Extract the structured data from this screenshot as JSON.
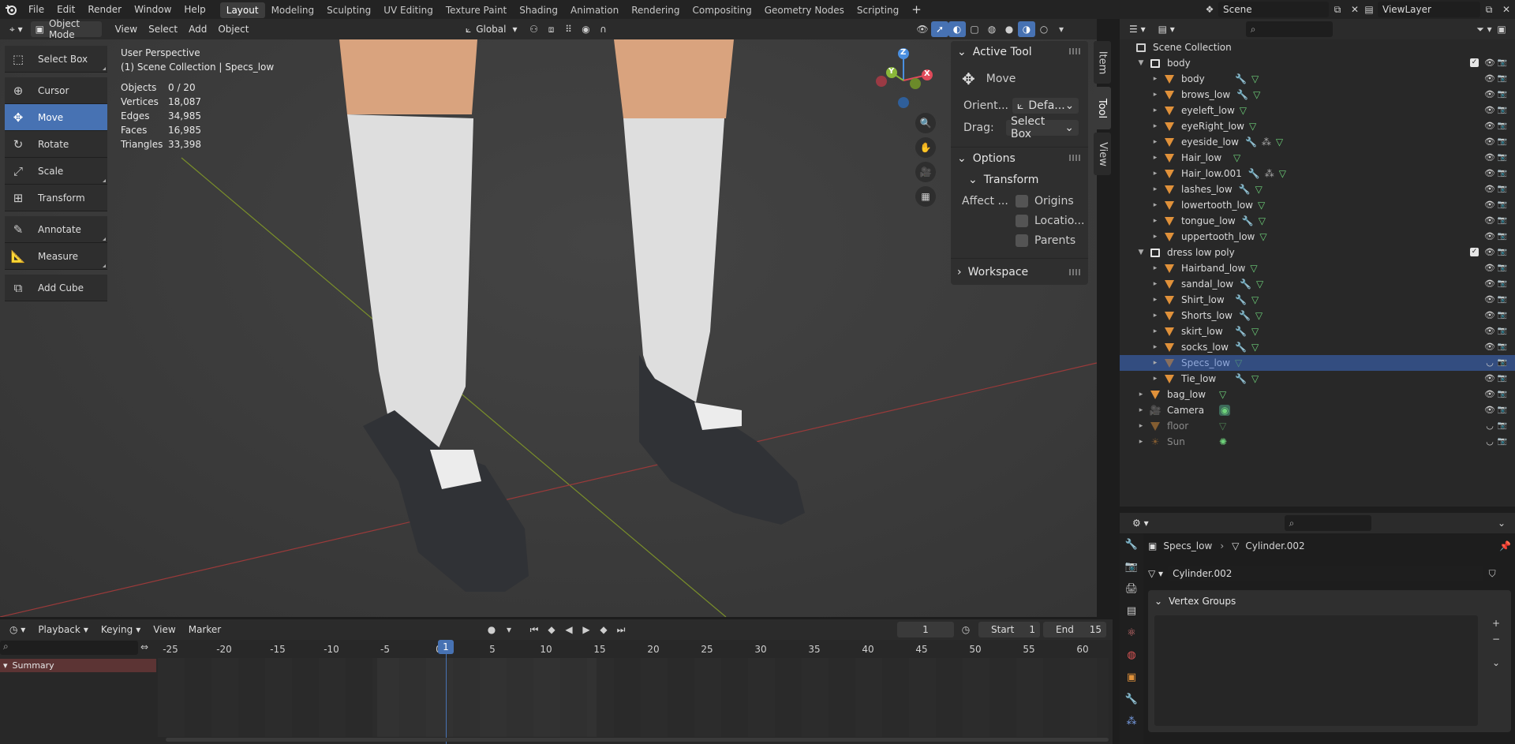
{
  "topbar": {
    "menus": [
      "File",
      "Edit",
      "Render",
      "Window",
      "Help"
    ],
    "workspaces": [
      "Layout",
      "Modeling",
      "Sculpting",
      "UV Editing",
      "Texture Paint",
      "Shading",
      "Animation",
      "Rendering",
      "Compositing",
      "Geometry Nodes",
      "Scripting"
    ],
    "active_workspace": "Layout",
    "add_tab": "+",
    "scene": "Scene",
    "view_layer": "ViewLayer"
  },
  "viewport_header": {
    "mode": "Object Mode",
    "menus": [
      "View",
      "Select",
      "Add",
      "Object"
    ],
    "orientation": "Global"
  },
  "overlay": {
    "perspective": "User Perspective",
    "collection": "(1) Scene Collection | Specs_low",
    "stats": [
      {
        "label": "Objects",
        "value": "0 / 20"
      },
      {
        "label": "Vertices",
        "value": "18,087"
      },
      {
        "label": "Edges",
        "value": "34,985"
      },
      {
        "label": "Faces",
        "value": "16,985"
      },
      {
        "label": "Triangles",
        "value": "33,398"
      }
    ]
  },
  "toolbox": {
    "tools": [
      {
        "label": "Select Box",
        "icon": "select-box-icon",
        "glyph": "⬚"
      },
      {
        "label": "Cursor",
        "icon": "cursor-icon",
        "glyph": "⊕"
      },
      {
        "label": "Move",
        "icon": "move-icon",
        "glyph": "✥"
      },
      {
        "label": "Rotate",
        "icon": "rotate-icon",
        "glyph": "↻"
      },
      {
        "label": "Scale",
        "icon": "scale-icon",
        "glyph": "⤢"
      },
      {
        "label": "Transform",
        "icon": "transform-icon",
        "glyph": "⊞"
      },
      {
        "label": "Annotate",
        "icon": "annotate-icon",
        "glyph": "✎"
      },
      {
        "label": "Measure",
        "icon": "measure-icon",
        "glyph": "📐"
      },
      {
        "label": "Add Cube",
        "icon": "add-cube-icon",
        "glyph": "⧉"
      }
    ],
    "active": "Move"
  },
  "gizmo": {
    "x": "X",
    "y": "Y",
    "z": "Z"
  },
  "npanel": {
    "active_tool_title": "Active Tool",
    "tool_name": "Move",
    "orient_label": "Orient...",
    "orient_value": "Defa...",
    "drag_label": "Drag:",
    "drag_value": "Select Box",
    "options_title": "Options",
    "transform_title": "Transform",
    "affect_label": "Affect ...",
    "checks": [
      "Origins",
      "Locatio...",
      "Parents"
    ],
    "workspace_title": "Workspace",
    "tabs": [
      "Item",
      "Tool",
      "View"
    ]
  },
  "outliner": {
    "root": "Scene Collection",
    "rows": [
      {
        "name": "body",
        "depth": 1,
        "kind": "collection",
        "mod": false,
        "extra": false,
        "mesh": false,
        "sel": false,
        "dim": false
      },
      {
        "name": "body",
        "depth": 2,
        "kind": "object",
        "mod": true,
        "extra": false,
        "mesh": true,
        "sel": false,
        "dim": false
      },
      {
        "name": "brows_low",
        "depth": 2,
        "kind": "object",
        "mod": true,
        "extra": false,
        "mesh": true,
        "sel": false,
        "dim": false
      },
      {
        "name": "eyeleft_low",
        "depth": 2,
        "kind": "object",
        "mod": false,
        "extra": false,
        "mesh": true,
        "sel": false,
        "dim": false
      },
      {
        "name": "eyeRight_low",
        "depth": 2,
        "kind": "object",
        "mod": false,
        "extra": false,
        "mesh": true,
        "sel": false,
        "dim": false
      },
      {
        "name": "eyeside_low",
        "depth": 2,
        "kind": "object",
        "mod": true,
        "extra": true,
        "mesh": true,
        "sel": false,
        "dim": false
      },
      {
        "name": "Hair_low",
        "depth": 2,
        "kind": "object",
        "mod": false,
        "extra": false,
        "mesh": true,
        "sel": false,
        "dim": false
      },
      {
        "name": "Hair_low.001",
        "depth": 2,
        "kind": "object",
        "mod": true,
        "extra": true,
        "mesh": true,
        "sel": false,
        "dim": false
      },
      {
        "name": "lashes_low",
        "depth": 2,
        "kind": "object",
        "mod": true,
        "extra": false,
        "mesh": true,
        "sel": false,
        "dim": false
      },
      {
        "name": "lowertooth_low",
        "depth": 2,
        "kind": "object",
        "mod": false,
        "extra": false,
        "mesh": true,
        "sel": false,
        "dim": false
      },
      {
        "name": "tongue_low",
        "depth": 2,
        "kind": "object",
        "mod": true,
        "extra": false,
        "mesh": true,
        "sel": false,
        "dim": false
      },
      {
        "name": "uppertooth_low",
        "depth": 2,
        "kind": "object",
        "mod": false,
        "extra": false,
        "mesh": true,
        "sel": false,
        "dim": false
      },
      {
        "name": "dress low poly",
        "depth": 1,
        "kind": "collection",
        "mod": false,
        "extra": false,
        "mesh": false,
        "sel": false,
        "dim": false
      },
      {
        "name": "Hairband_low",
        "depth": 2,
        "kind": "object",
        "mod": false,
        "extra": false,
        "mesh": true,
        "sel": false,
        "dim": false
      },
      {
        "name": "sandal_low",
        "depth": 2,
        "kind": "object",
        "mod": true,
        "extra": false,
        "mesh": true,
        "sel": false,
        "dim": false
      },
      {
        "name": "Shirt_low",
        "depth": 2,
        "kind": "object",
        "mod": true,
        "extra": false,
        "mesh": true,
        "sel": false,
        "dim": false
      },
      {
        "name": "Shorts_low",
        "depth": 2,
        "kind": "object",
        "mod": true,
        "extra": false,
        "mesh": true,
        "sel": false,
        "dim": false
      },
      {
        "name": "skirt_low",
        "depth": 2,
        "kind": "object",
        "mod": true,
        "extra": false,
        "mesh": true,
        "sel": false,
        "dim": false
      },
      {
        "name": "socks_low",
        "depth": 2,
        "kind": "object",
        "mod": true,
        "extra": false,
        "mesh": true,
        "sel": false,
        "dim": false
      },
      {
        "name": "Specs_low",
        "depth": 2,
        "kind": "object",
        "mod": false,
        "extra": false,
        "mesh": true,
        "sel": true,
        "dim": true
      },
      {
        "name": "Tie_low",
        "depth": 2,
        "kind": "object",
        "mod": true,
        "extra": false,
        "mesh": true,
        "sel": false,
        "dim": false
      },
      {
        "name": "bag_low",
        "depth": 1,
        "kind": "object",
        "mod": false,
        "extra": false,
        "mesh": true,
        "sel": false,
        "dim": false
      },
      {
        "name": "Camera",
        "depth": 1,
        "kind": "camera",
        "mod": false,
        "extra": false,
        "mesh": false,
        "sel": false,
        "dim": false
      },
      {
        "name": "floor",
        "depth": 1,
        "kind": "object",
        "mod": false,
        "extra": false,
        "mesh": true,
        "sel": false,
        "dim": true
      },
      {
        "name": "Sun",
        "depth": 1,
        "kind": "light",
        "mod": false,
        "extra": false,
        "mesh": false,
        "sel": false,
        "dim": true
      }
    ]
  },
  "properties": {
    "object": "Specs_low",
    "mesh": "Cylinder.002",
    "mesh_field": "Cylinder.002",
    "section": "Vertex Groups"
  },
  "timeline": {
    "menus": [
      "Playback",
      "Keying",
      "View",
      "Marker"
    ],
    "current_frame": "1",
    "start_label": "Start",
    "start": "1",
    "end_label": "End",
    "end": "15",
    "summary": "Summary",
    "ticks": [
      "-25",
      "-20",
      "-15",
      "-10",
      "-5",
      "0",
      "5",
      "10",
      "15",
      "20",
      "25",
      "30",
      "35",
      "40",
      "45",
      "50",
      "55",
      "60"
    ],
    "playhead": "1"
  },
  "colors": {
    "accent": "#4772b3",
    "object": "#e0913a",
    "mesh": "#6ed27a",
    "modifier": "#7aa0e8"
  }
}
